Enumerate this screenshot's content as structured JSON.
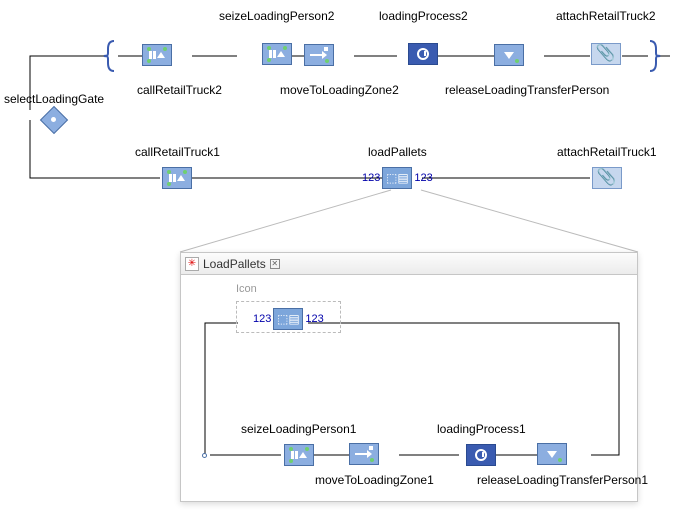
{
  "labels": {
    "selectLoadingGate": "selectLoadingGate",
    "callRetailTruck2": "callRetailTruck2",
    "seizeLoadingPerson2": "seizeLoadingPerson2",
    "moveToLoadingZone2": "moveToLoadingZone2",
    "loadingProcess2": "loadingProcess2",
    "releaseLoadingTransferPerson": "releaseLoadingTransferPerson",
    "attachRetailTruck2": "attachRetailTruck2",
    "callRetailTruck1": "callRetailTruck1",
    "loadPallets": "loadPallets",
    "attachRetailTruck1": "attachRetailTruck1"
  },
  "counts": {
    "loadPalletsIn": "123",
    "loadPalletsOut": "123"
  },
  "subpanel": {
    "title": "LoadPallets",
    "iconLabel": "Icon",
    "counts": {
      "in": "123",
      "out": "123"
    },
    "labels": {
      "seizeLoadingPerson1": "seizeLoadingPerson1",
      "moveToLoadingZone1": "moveToLoadingZone1",
      "loadingProcess1": "loadingProcess1",
      "releaseLoadingTransferPerson1": "releaseLoadingTransferPerson1"
    }
  }
}
